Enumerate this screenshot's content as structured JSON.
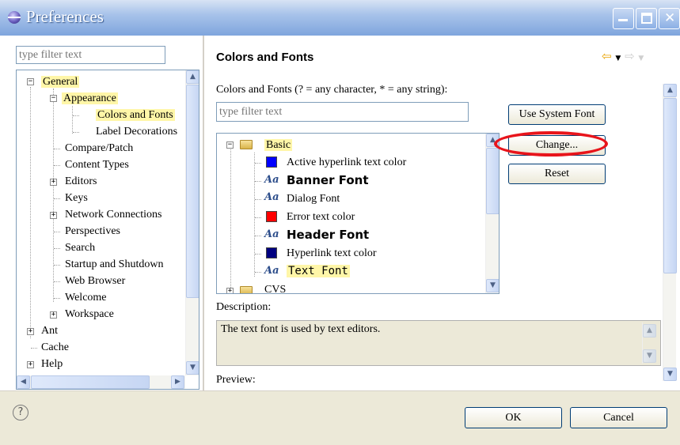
{
  "window": {
    "title": "Preferences"
  },
  "left": {
    "filter_placeholder": "type filter text",
    "tree": [
      {
        "label": "General",
        "highlight": true
      },
      {
        "label": "Appearance",
        "highlight": true
      },
      {
        "label": "Colors and Fonts",
        "highlight": true
      },
      {
        "label": "Label Decorations"
      },
      {
        "label": "Compare/Patch"
      },
      {
        "label": "Content Types"
      },
      {
        "label": "Editors"
      },
      {
        "label": "Keys"
      },
      {
        "label": "Network Connections"
      },
      {
        "label": "Perspectives"
      },
      {
        "label": "Search"
      },
      {
        "label": "Startup and Shutdown"
      },
      {
        "label": "Web Browser"
      },
      {
        "label": "Welcome"
      },
      {
        "label": "Workspace"
      },
      {
        "label": "Ant"
      },
      {
        "label": "Cache"
      },
      {
        "label": "Help"
      }
    ]
  },
  "right": {
    "title": "Colors and Fonts",
    "instructions": "Colors and Fonts (? = any character, * = any string):",
    "filter_placeholder": "type filter text",
    "tree": {
      "category": "Basic",
      "items": [
        {
          "label": "Active hyperlink text color",
          "kind": "color",
          "color": "#0000ff"
        },
        {
          "label": "Banner Font",
          "kind": "font",
          "bold": true
        },
        {
          "label": "Dialog Font",
          "kind": "font"
        },
        {
          "label": "Error text color",
          "kind": "color",
          "color": "#ff0000"
        },
        {
          "label": "Header Font",
          "kind": "font",
          "bold": true
        },
        {
          "label": "Hyperlink text color",
          "kind": "color",
          "color": "#000080"
        },
        {
          "label": "Text Font",
          "kind": "font",
          "mono": true,
          "highlight": true
        }
      ],
      "next_category": "CVS"
    },
    "buttons": {
      "use_system_font": "Use System Font",
      "change": "Change...",
      "reset": "Reset"
    },
    "description_label": "Description:",
    "description_text": "The text font is used by text editors.",
    "preview_label": "Preview:"
  },
  "footer": {
    "help": "?",
    "ok": "OK",
    "cancel": "Cancel"
  },
  "colors": {
    "highlight": "#fff6a8",
    "annotation_ring": "#e8141b"
  }
}
